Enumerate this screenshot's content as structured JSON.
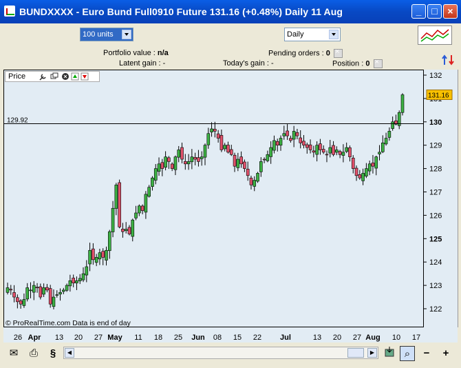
{
  "window": {
    "title": "BUNDXXXX - Euro Bund Full0910 Future    131.16 (+0.48%)   Daily  11 Aug",
    "minimize_glyph": "_",
    "maximize_glyph": "□",
    "close_glyph": "×"
  },
  "toolbar": {
    "units_select": "100 units",
    "period_select": "Daily"
  },
  "info": {
    "portfolio_label": "Portfolio value :",
    "portfolio_value": "n/a",
    "pending_label": "Pending orders :",
    "pending_value": "0",
    "latent_label": "Latent gain :",
    "latent_value": "-",
    "today_label": "Today's gain :",
    "today_value": "-",
    "position_label": "Position :",
    "position_value": "0"
  },
  "legend": {
    "label": "Price"
  },
  "footer_note": "© ProRealTime.com  Data is end of day",
  "horizontal_line_label": "129.92",
  "last_price_label": "131.16",
  "chart_data": {
    "type": "candlestick",
    "title": "",
    "ylim": [
      121.6,
      132.2
    ],
    "yticks": [
      "132",
      "131",
      "130",
      "129",
      "128",
      "127",
      "126",
      "125",
      "124",
      "123",
      "122"
    ],
    "yticks_bold": [
      "130",
      "125"
    ],
    "xticks": [
      "26",
      "Apr",
      "13",
      "20",
      "27",
      "May",
      "11",
      "18",
      "25",
      "Jun",
      "08",
      "15",
      "22",
      "Jul",
      "13",
      "20",
      "27",
      "Aug",
      "10",
      "17"
    ],
    "xticks_bold": [
      "Apr",
      "May",
      "Jun",
      "Jul",
      "Aug"
    ],
    "horizontal_line": 129.92,
    "last_price": 131.16,
    "close_series": [
      122.9,
      122.8,
      122.5,
      122.3,
      122.2,
      122.4,
      122.9,
      122.8,
      123.0,
      122.9,
      122.5,
      122.9,
      122.8,
      122.2,
      122.5,
      122.6,
      122.7,
      122.8,
      123.0,
      123.2,
      123.1,
      123.2,
      123.3,
      123.5,
      123.8,
      124.5,
      124.1,
      124.2,
      124.4,
      124.2,
      124.5,
      125.3,
      126.3,
      127.3,
      125.5,
      125.3,
      125.4,
      125.2,
      125.8,
      126.1,
      126.4,
      126.2,
      126.9,
      127.2,
      127.6,
      128.0,
      128.2,
      128.0,
      128.5,
      128.3,
      128.0,
      128.5,
      128.8,
      128.4,
      128.2,
      128.3,
      128.5,
      128.4,
      128.3,
      128.5,
      129.0,
      129.5,
      129.7,
      129.6,
      129.3,
      128.8,
      129.0,
      128.7,
      128.6,
      128.1,
      128.4,
      128.2,
      128.0,
      127.7,
      127.3,
      127.5,
      127.8,
      128.3,
      128.4,
      128.6,
      128.9,
      129.2,
      129.0,
      129.3,
      129.5,
      129.4,
      129.2,
      129.6,
      129.4,
      129.1,
      129.0,
      128.9,
      128.8,
      128.7,
      129.0,
      128.8,
      128.7,
      128.6,
      128.9,
      128.6,
      128.8,
      128.6,
      128.7,
      128.9,
      128.5,
      128.0,
      127.7,
      127.6,
      127.8,
      128.0,
      128.2,
      128.1,
      128.5,
      128.7,
      129.1,
      129.3,
      129.6,
      130.0,
      129.9,
      130.4,
      131.16
    ]
  },
  "bottom": {
    "mail_icon": "✉",
    "print_icon": "⎙",
    "link_icon": "§",
    "scroll_left": "◀",
    "scroll_right": "▶",
    "zoom_icon": "⌕",
    "zoom_out_icon": "−",
    "zoom_in_icon": "+"
  }
}
